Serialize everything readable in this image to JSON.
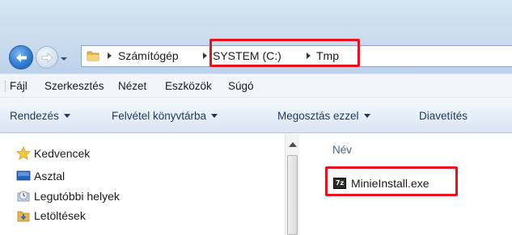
{
  "address_bar": {
    "crumbs": [
      "Számítógép",
      "SYSTEM (C:)",
      "Tmp"
    ]
  },
  "menu": {
    "items": [
      "Fájl",
      "Szerkesztés",
      "Nézet",
      "Eszközök",
      "Súgó"
    ]
  },
  "command_bar": {
    "items": [
      "Rendezés",
      "Felvétel könyvtárba",
      "Megosztás ezzel",
      "Diavetítés"
    ]
  },
  "nav_pane": {
    "items": [
      {
        "label": "Kedvencek",
        "icon": "star-icon"
      },
      {
        "label": "Asztal",
        "icon": "desktop-icon"
      },
      {
        "label": "Legutóbbi helyek",
        "icon": "recent-places-icon"
      },
      {
        "label": "Letöltések",
        "icon": "downloads-folder-icon"
      }
    ]
  },
  "file_list": {
    "column_header": "Név",
    "files": [
      {
        "name": "MinieInstall.exe",
        "icon": "7zip-exe-icon",
        "icon_text": "7z"
      }
    ]
  },
  "colors": {
    "highlight": "#e8121c",
    "accent": "#1e395b"
  }
}
